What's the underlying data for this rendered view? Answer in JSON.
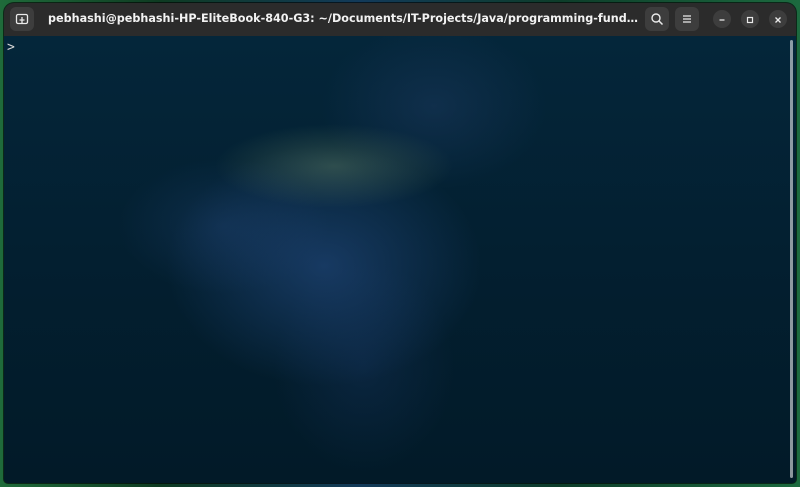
{
  "window": {
    "title": "pebhashi@pebhashi-HP-EliteBook-840-G3: ~/Documents/IT-Projects/Java/programming-fundamentals/exam-resul..."
  },
  "headerbar": {
    "new_tab_icon": "new-tab-icon",
    "search_icon": "search-icon",
    "menu_icon": "hamburger-menu-icon",
    "minimize_icon": "minimize-icon",
    "maximize_icon": "maximize-icon",
    "close_icon": "close-icon"
  },
  "terminal": {
    "prompt": ">"
  },
  "colors": {
    "headerbar_bg": "#2b2b2b",
    "button_bg": "#3d3d3d",
    "terminal_bg": "#021a26",
    "text": "#d8d8d8"
  }
}
